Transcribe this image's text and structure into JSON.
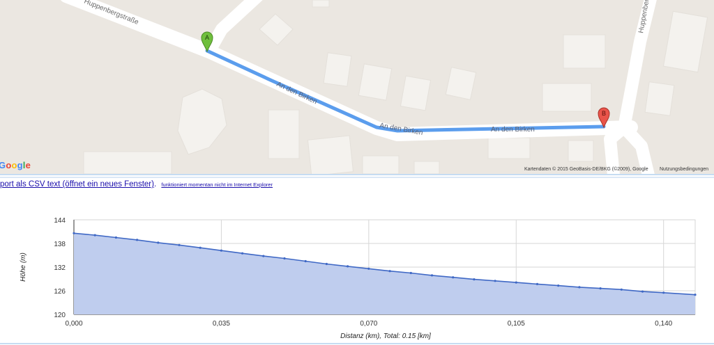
{
  "map": {
    "streets": [
      "Huppenbergstraße",
      "An den Birken",
      "An den Birken",
      "An den Birken",
      "Huppenberg"
    ],
    "marker_a": "A",
    "marker_b": "B",
    "logo_text": "Google",
    "attribution": "Kartendaten © 2015 GeoBasis-DE/BKG (©2009), Google",
    "terms": "Nutzungsbedingungen",
    "colors": {
      "route": "#5b9ded",
      "road": "#ffffff",
      "land": "#ebe7e1",
      "building": "#f4f2ee",
      "marker_a": "#6fbf3c",
      "marker_b": "#e9544a"
    }
  },
  "export": {
    "link_text": "port als CSV text (öffnet ein neues Fenster)",
    "note": "funktioniert momentan nicht im Internet Explorer"
  },
  "chart_data": {
    "type": "area",
    "xlabel": "Distanz (km), Total: 0.15 [km]",
    "ylabel": "Höhe (m)",
    "xlim": [
      0,
      0.1475
    ],
    "ylim": [
      120,
      144
    ],
    "x_ticks": [
      "0,000",
      "0,035",
      "0,070",
      "0,105",
      "0,140"
    ],
    "x_tick_values": [
      0,
      0.035,
      0.07,
      0.105,
      0.14
    ],
    "y_ticks": [
      "144",
      "138",
      "132",
      "126",
      "120"
    ],
    "y_tick_values": [
      144,
      138,
      132,
      126,
      120
    ],
    "grid": true,
    "series": [
      {
        "x": [
          0,
          0.005,
          0.01,
          0.015,
          0.02,
          0.025,
          0.03,
          0.035,
          0.04,
          0.045,
          0.05,
          0.055,
          0.06,
          0.065,
          0.07,
          0.075,
          0.08,
          0.085,
          0.09,
          0.095,
          0.1,
          0.105,
          0.11,
          0.115,
          0.12,
          0.125,
          0.13,
          0.135,
          0.14,
          0.1475
        ],
        "values": [
          140.6,
          140.1,
          139.5,
          138.9,
          138.2,
          137.6,
          136.9,
          136.2,
          135.5,
          134.8,
          134.2,
          133.5,
          132.8,
          132.2,
          131.6,
          131.0,
          130.5,
          129.9,
          129.4,
          128.9,
          128.5,
          128.1,
          127.7,
          127.3,
          126.9,
          126.6,
          126.3,
          125.8,
          125.5,
          125.0
        ]
      }
    ],
    "colors": {
      "fill": "#bfcdee",
      "line": "#3f68c5",
      "grid": "#d6d6d6"
    }
  }
}
